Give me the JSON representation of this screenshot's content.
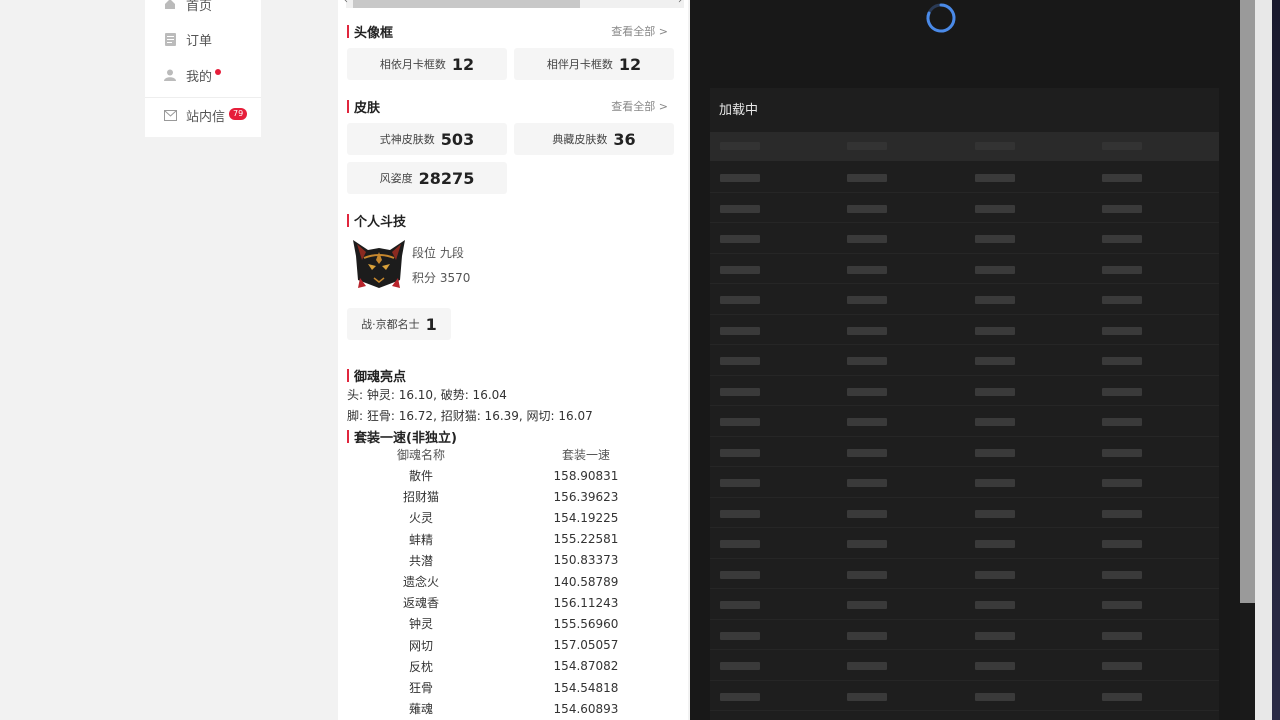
{
  "nav": {
    "items": [
      {
        "label": "首页",
        "icon": "home-icon"
      },
      {
        "label": "订单",
        "icon": "order-icon"
      },
      {
        "label": "我的",
        "icon": "user-icon"
      }
    ],
    "inbox": {
      "label": "站内信",
      "badge": "79"
    }
  },
  "avatar_frame": {
    "title": "头像框",
    "more": "查看全部 >",
    "stats": [
      {
        "label": "相依月卡框数",
        "value": "12"
      },
      {
        "label": "相伴月卡框数",
        "value": "12"
      }
    ]
  },
  "skins": {
    "title": "皮肤",
    "more": "查看全部 >",
    "stats": [
      {
        "label": "式神皮肤数",
        "value": "503"
      },
      {
        "label": "典藏皮肤数",
        "value": "36"
      },
      {
        "label": "风姿度",
        "value": "28275"
      }
    ]
  },
  "pvp": {
    "title": "个人斗技",
    "rank_label": "段位",
    "rank": "九段",
    "score_label": "积分",
    "score": "3570",
    "badge_label": "战·京都名士",
    "badge_value": "1"
  },
  "yuhun_highlight": {
    "title": "御魂亮点",
    "line1": "头: 钟灵: 16.10, 破势: 16.04",
    "line2": "脚: 狂骨: 16.72, 招财猫: 16.39, 网切: 16.07"
  },
  "set_speed": {
    "title": "套装一速(非独立)",
    "col1": "御魂名称",
    "col2": "套装一速",
    "rows": [
      {
        "name": "散件",
        "speed": "158.90831"
      },
      {
        "name": "招财猫",
        "speed": "156.39623"
      },
      {
        "name": "火灵",
        "speed": "154.19225"
      },
      {
        "name": "蚌精",
        "speed": "155.22581"
      },
      {
        "name": "共潜",
        "speed": "150.83373"
      },
      {
        "name": "遗念火",
        "speed": "140.58789"
      },
      {
        "name": "返魂香",
        "speed": "156.11243"
      },
      {
        "name": "钟灵",
        "speed": "155.56960"
      },
      {
        "name": "网切",
        "speed": "157.05057"
      },
      {
        "name": "反枕",
        "speed": "154.87082"
      },
      {
        "name": "狂骨",
        "speed": "154.54818"
      },
      {
        "name": "薙魂",
        "speed": "154.60893"
      }
    ]
  },
  "loading_panel": {
    "title": "加载中",
    "accent": "#3a7bd5"
  }
}
